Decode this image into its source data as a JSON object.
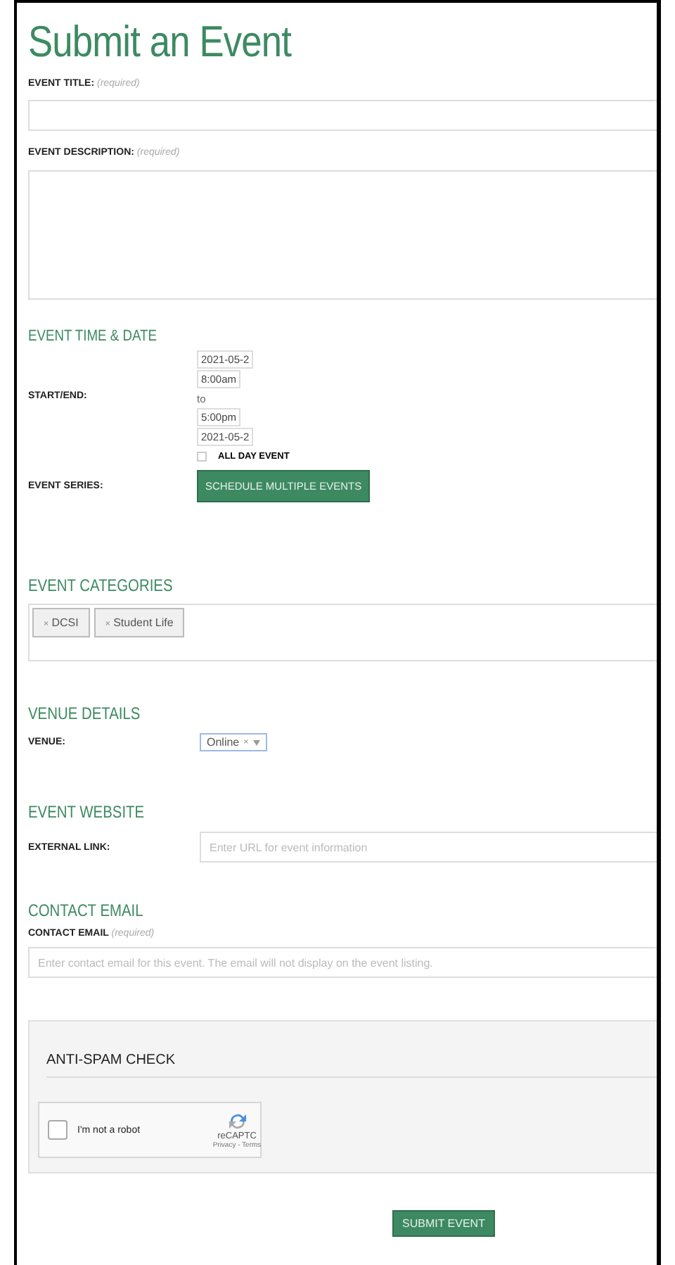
{
  "page_title": "Submit an Event",
  "event_title": {
    "label": "EVENT TITLE:",
    "note": "(required)"
  },
  "event_description": {
    "label": "EVENT DESCRIPTION:",
    "note": "(required)"
  },
  "time_date": {
    "heading": "EVENT TIME & DATE",
    "label": "START/END:",
    "start_date": "2021-05-2",
    "start_time": "8:00am",
    "separator": "to",
    "end_time": "5:00pm",
    "end_date": "2021-05-2",
    "all_day": {
      "label": "ALL DAY EVENT",
      "checked": false
    },
    "series_label": "EVENT SERIES:",
    "series_button": "SCHEDULE MULTIPLE EVENTS"
  },
  "categories": {
    "heading": "EVENT CATEGORIES",
    "tags": [
      {
        "remove": "×",
        "label": "DCSI"
      },
      {
        "remove": "×",
        "label": "Student Life"
      }
    ]
  },
  "venue": {
    "heading": "VENUE DETAILS",
    "label": "VENUE:",
    "value": "Online",
    "clear": "×"
  },
  "website": {
    "heading": "EVENT WEBSITE",
    "label": "EXTERNAL LINK:",
    "placeholder": "Enter URL for event information"
  },
  "contact": {
    "heading": "CONTACT EMAIL",
    "label": "CONTACT EMAIL",
    "note": "(required)",
    "placeholder": "Enter contact email for this event. The email will not display on the event listing."
  },
  "anti_spam": {
    "heading": "ANTI-SPAM CHECK",
    "checkbox_label": "I'm not a robot",
    "checked": false,
    "brand": "reCAPTC",
    "links": "Privacy - Terms"
  },
  "submit_button": "SUBMIT EVENT"
}
